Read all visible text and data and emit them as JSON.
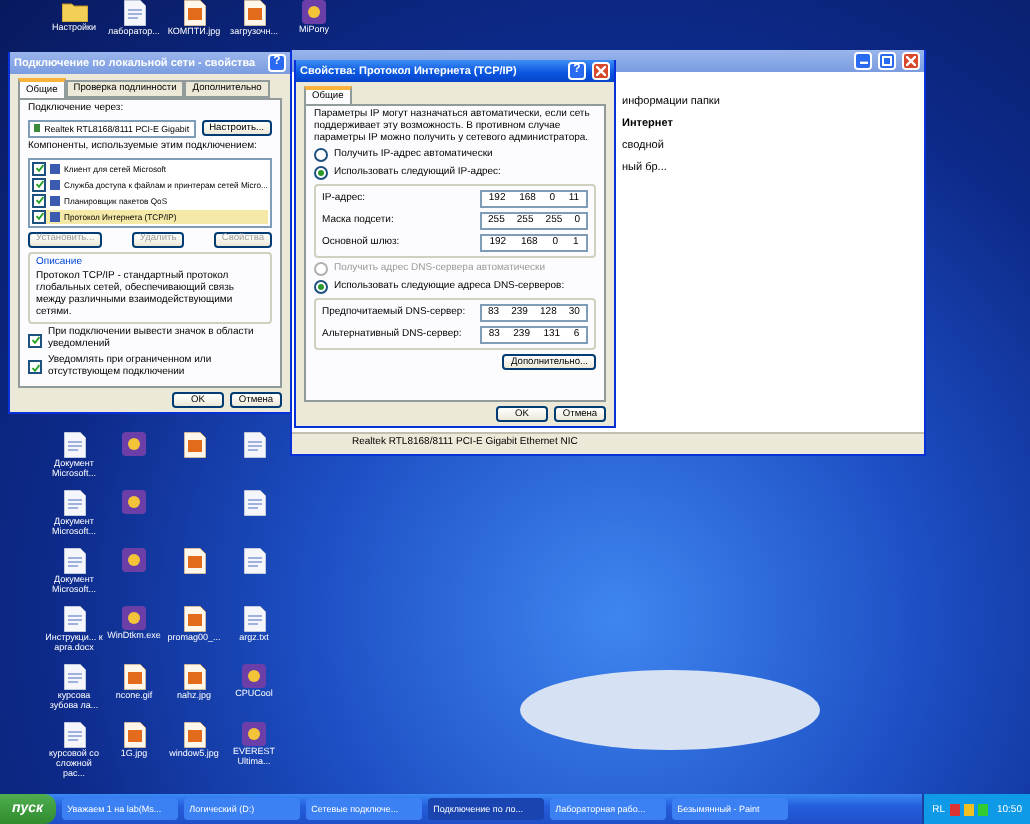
{
  "desktop": {
    "top_icons": [
      {
        "label": "Настройки",
        "kind": "folder"
      },
      {
        "label": "лаборатор...",
        "kind": "doc"
      },
      {
        "label": "КОМПТИ.jpg",
        "kind": "image"
      },
      {
        "label": "загрузочн...",
        "kind": "image"
      },
      {
        "label": "MiPony",
        "kind": "app"
      }
    ],
    "icon_columns": [
      [
        {
          "label": "Документ Microsoft...",
          "kind": "doc"
        },
        {
          "label": "Документ Microsoft...",
          "kind": "doc"
        },
        {
          "label": "Документ Microsoft...",
          "kind": "doc"
        },
        {
          "label": "Инструкци... к apra.docx",
          "kind": "doc"
        },
        {
          "label": "курсова зубова ла...",
          "kind": "doc"
        },
        {
          "label": "курсовой со сложной рас...",
          "kind": "doc"
        }
      ],
      [
        {
          "kind": "app"
        },
        {
          "kind": "app"
        },
        {
          "kind": "app"
        },
        {
          "label": "WinDtkm.exe",
          "kind": "app"
        },
        {
          "label": "ncone.gif",
          "kind": "image"
        },
        {
          "label": "1G.jpg",
          "kind": "image"
        }
      ],
      [
        {
          "kind": "image"
        },
        {
          "kind": "none"
        },
        {
          "kind": "image"
        },
        {
          "label": "promag00_...",
          "kind": "image"
        },
        {
          "label": "nahz.jpg",
          "kind": "image"
        },
        {
          "label": "window5.jpg",
          "kind": "image"
        }
      ],
      [
        {
          "kind": "doc"
        },
        {
          "kind": "doc"
        },
        {
          "kind": "doc"
        },
        {
          "label": "argz.txt",
          "kind": "doc"
        },
        {
          "label": "CPUCool",
          "kind": "app"
        },
        {
          "label": "EVEREST Ultima...",
          "kind": "app"
        }
      ]
    ]
  },
  "explorer": {
    "lines": [
      {
        "text": "информации папки",
        "bold": false
      },
      {
        "text": "Интернет",
        "bold": true
      },
      {
        "text": "сводной",
        "bold": false
      },
      {
        "text": "ный бр...",
        "bold": false
      }
    ],
    "status": "Realtek RTL8168/8111 PCI-E Gigabit Ethernet NIC"
  },
  "lan_dialog": {
    "title": "Подключение по локальной сети - свойства",
    "help": "?",
    "tabs": [
      {
        "label": "Общие",
        "selected": true
      },
      {
        "label": "Проверка подлинности",
        "selected": false
      },
      {
        "label": "Дополнительно",
        "selected": false
      }
    ],
    "connect_label": "Подключение через:",
    "adapter": "Realtek RTL8168/8111 PCI-E Gigabit",
    "configure": "Настроить...",
    "components_label": "Компоненты, используемые этим подключением:",
    "components": [
      {
        "label": "Клиент для сетей Microsoft",
        "checked": true,
        "selected": false
      },
      {
        "label": "Служба доступа к файлам и принтерам сетей Micro...",
        "checked": true,
        "selected": false
      },
      {
        "label": "Планировщик пакетов QoS",
        "checked": true,
        "selected": false
      },
      {
        "label": "Протокол Интернета (TCP/IP)",
        "checked": true,
        "selected": true
      }
    ],
    "component_buttons": [
      {
        "label": "Установить...",
        "disabled": true
      },
      {
        "label": "Удалить",
        "disabled": true
      },
      {
        "label": "Свойства",
        "disabled": true
      }
    ],
    "description_title": "Описание",
    "description": "Протокол TCP/IP - стандартный протокол глобальных сетей, обеспечивающий связь между различными взаимодействующими сетями.",
    "options": [
      {
        "label": "При подключении вывести значок в области уведомлений",
        "checked": true
      },
      {
        "label": "Уведомлять при ограниченном или отсутствующем подключении",
        "checked": true
      }
    ],
    "buttons": [
      "OK",
      "Отмена"
    ]
  },
  "tcpip_dialog": {
    "title": "Свойства: Протокол Интернета (TCP/IP)",
    "help": "?",
    "tab": "Общие",
    "intro": "Параметры IP могут назначаться автоматически, если сеть поддерживает эту возможность. В противном случае параметры IP можно получить у сетевого администратора.",
    "ip_radios": [
      {
        "label": "Получить IP-адрес автоматически",
        "selected": false,
        "disabled": false
      },
      {
        "label": "Использовать следующий IP-адрес:",
        "selected": true,
        "disabled": false
      }
    ],
    "ip_fields": [
      {
        "label": "IP-адрес:",
        "octets": [
          "192",
          "168",
          "0",
          "11"
        ]
      },
      {
        "label": "Маска подсети:",
        "octets": [
          "255",
          "255",
          "255",
          "0"
        ]
      },
      {
        "label": "Основной шлюз:",
        "octets": [
          "192",
          "168",
          "0",
          "1"
        ]
      }
    ],
    "dns_radios": [
      {
        "label": "Получить адрес DNS-сервера автоматически",
        "selected": false,
        "disabled": true
      },
      {
        "label": "Использовать следующие адреса DNS-серверов:",
        "selected": true,
        "disabled": false
      }
    ],
    "dns_fields": [
      {
        "label": "Предпочитаемый DNS-сервер:",
        "octets": [
          "83",
          "239",
          "128",
          "30"
        ]
      },
      {
        "label": "Альтернативный DNS-сервер:",
        "octets": [
          "83",
          "239",
          "131",
          "6"
        ]
      }
    ],
    "advanced": "Дополнительно...",
    "buttons": [
      "OK",
      "Отмена"
    ]
  },
  "taskbar": {
    "start": "пуск",
    "items": [
      {
        "label": "Уважаем 1 на lab(Ms...",
        "selected": false
      },
      {
        "label": "Логический (D:)",
        "selected": false
      },
      {
        "label": "Сетевые подключе...",
        "selected": false
      },
      {
        "label": "Подключение по ло...",
        "selected": true
      },
      {
        "label": "Лабораторная рабо...",
        "selected": false
      },
      {
        "label": "Безымянный - Paint",
        "selected": false
      }
    ],
    "lang": "RL",
    "clock": "10:50"
  }
}
